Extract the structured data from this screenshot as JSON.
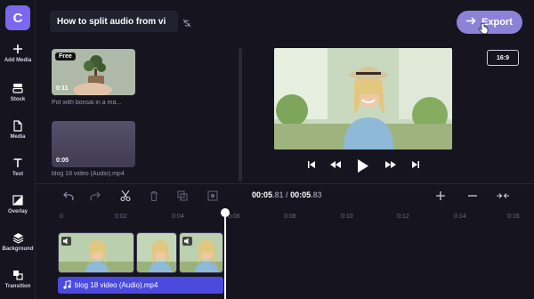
{
  "app": {
    "logo_letter": "C"
  },
  "sidebar": {
    "items": [
      {
        "label": "Add Media",
        "icon": "plus-icon"
      },
      {
        "label": "Stock",
        "icon": "stock-icon"
      },
      {
        "label": "Media",
        "icon": "media-icon"
      },
      {
        "label": "Text",
        "icon": "text-icon"
      },
      {
        "label": "Overlay",
        "icon": "overlay-icon"
      },
      {
        "label": "Background",
        "icon": "background-icon"
      },
      {
        "label": "Transition",
        "icon": "transition-icon"
      }
    ]
  },
  "header": {
    "project_title": "How to split audio from vi",
    "export_label": "Export"
  },
  "library": {
    "items": [
      {
        "badge": "Free",
        "duration": "0:11",
        "label": "Pot with bonsai in a ma..."
      },
      {
        "badge": "",
        "duration": "0:05",
        "label": "blog 18 video (Audio).mp4"
      }
    ]
  },
  "preview": {
    "aspect_ratio": "16:9"
  },
  "timeline": {
    "current_time": "00:05",
    "current_time_frac": ".81",
    "separator": " / ",
    "total_time": "00:05",
    "total_time_frac": ".83",
    "ruler_ticks": [
      "0",
      "0:02",
      "0:04",
      "0:06",
      "0:08",
      "0:10",
      "0:12",
      "0:14",
      "0:16"
    ],
    "audio_clip_label": "blog 18 video (Audio).mp4"
  },
  "colors": {
    "accent": "#8c83d8",
    "logo": "#7b68ee",
    "audio_track": "#4b4adf",
    "background": "#15141f"
  }
}
